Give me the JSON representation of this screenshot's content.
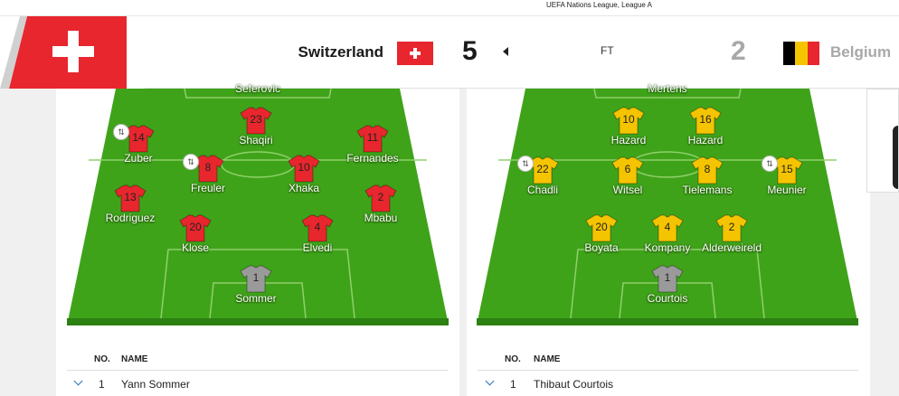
{
  "competition": "UEFA Nations League, League A",
  "match": {
    "home": {
      "name": "Switzerland",
      "score": "5"
    },
    "away": {
      "name": "Belgium",
      "score": "2"
    },
    "status": "FT"
  },
  "colors": {
    "pitch": "#3fa31a",
    "pitch_line": "#8fd06a",
    "swiss_red": "#e8262d",
    "belgium_yellow": "#f5c400",
    "keeper_grey": "#9a9a9a",
    "link_blue": "#2a6ebb"
  },
  "lineups": {
    "home": {
      "cutoff_name": "Seferovic",
      "players": [
        {
          "num": "23",
          "name": "Shaqiri",
          "kit": "red",
          "sub": false
        },
        {
          "num": "14",
          "name": "Zuber",
          "kit": "red",
          "sub": true
        },
        {
          "num": "11",
          "name": "Fernandes",
          "kit": "red",
          "sub": false
        },
        {
          "num": "8",
          "name": "Freuler",
          "kit": "red",
          "sub": true
        },
        {
          "num": "10",
          "name": "Xhaka",
          "kit": "red",
          "sub": false
        },
        {
          "num": "13",
          "name": "Rodriguez",
          "kit": "red",
          "sub": false
        },
        {
          "num": "2",
          "name": "Mbabu",
          "kit": "red",
          "sub": false
        },
        {
          "num": "20",
          "name": "Klose",
          "kit": "red",
          "sub": false
        },
        {
          "num": "4",
          "name": "Elvedi",
          "kit": "red",
          "sub": false
        },
        {
          "num": "1",
          "name": "Sommer",
          "kit": "grey",
          "sub": false
        }
      ]
    },
    "away": {
      "cutoff_name": "Mertens",
      "players": [
        {
          "num": "10",
          "name": "Hazard",
          "kit": "yellow",
          "sub": false
        },
        {
          "num": "16",
          "name": "Hazard",
          "kit": "yellow",
          "sub": false
        },
        {
          "num": "22",
          "name": "Chadli",
          "kit": "yellow",
          "sub": true
        },
        {
          "num": "6",
          "name": "Witsel",
          "kit": "yellow",
          "sub": false
        },
        {
          "num": "8",
          "name": "Tielemans",
          "kit": "yellow",
          "sub": false
        },
        {
          "num": "15",
          "name": "Meunier",
          "kit": "yellow",
          "sub": true
        },
        {
          "num": "20",
          "name": "Boyata",
          "kit": "yellow",
          "sub": false
        },
        {
          "num": "4",
          "name": "Kompany",
          "kit": "yellow",
          "sub": false
        },
        {
          "num": "2",
          "name": "Alderweireld",
          "kit": "yellow",
          "sub": false
        },
        {
          "num": "1",
          "name": "Courtois",
          "kit": "grey",
          "sub": false
        }
      ]
    }
  },
  "table": {
    "col_no": "NO.",
    "col_name": "NAME",
    "home_rows": [
      {
        "no": "1",
        "name": "Yann Sommer"
      }
    ],
    "away_rows": [
      {
        "no": "1",
        "name": "Thibaut Courtois"
      }
    ]
  }
}
